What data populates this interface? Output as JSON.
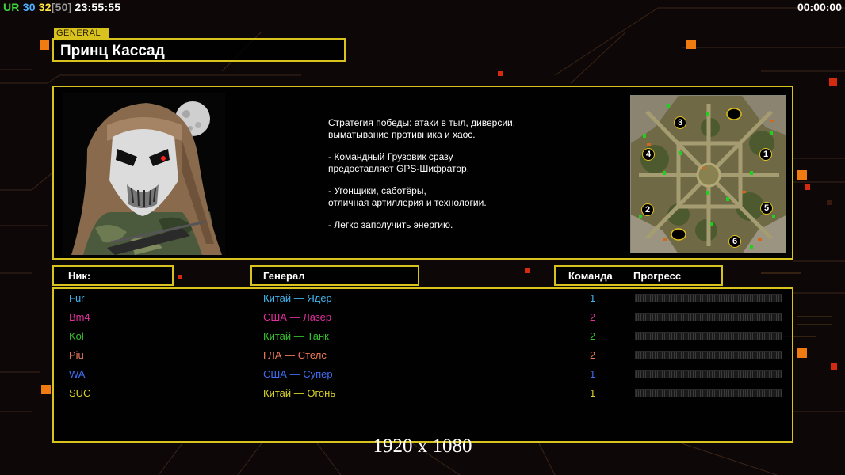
{
  "hud": {
    "left_parts": [
      {
        "text": "UR ",
        "color": "#3fd43f"
      },
      {
        "text": "30 ",
        "color": "#4ab0ff"
      },
      {
        "text": "32",
        "color": "#ffe640"
      },
      {
        "text": "[50]",
        "color": "#9a9a9a"
      },
      {
        "text": " 23:55:55",
        "color": "#ffffff"
      }
    ],
    "timer": "00:00:00"
  },
  "general": {
    "tag": "GENERAL",
    "name": "Принц Кассад",
    "description": [
      "Стратегия победы: атаки в тыл, диверсии,\n выматывание противника и хаос.",
      "- Командный Грузовик сразу\nпредоставляет GPS-Шифратор.",
      "- Угонщики, саботёры,\nотличная артиллерия и технологии.",
      "- Легко заполучить энергию."
    ]
  },
  "minimap": {
    "start_positions": [
      "1",
      "2",
      "3",
      "4",
      "5",
      "6"
    ]
  },
  "table": {
    "headers": {
      "nick": "Ник:",
      "general": "Генерал",
      "team": "Команда",
      "progress": "Прогресс"
    },
    "players": [
      {
        "nick": "Fur",
        "general": "Китай — Ядер",
        "team": "1",
        "color": "#3fb6ee",
        "progress": 0
      },
      {
        "nick": "Bm4",
        "general": "США — Лазер",
        "team": "2",
        "color": "#e0309c",
        "progress": 0
      },
      {
        "nick": "Kol",
        "general": "Китай — Танк",
        "team": "2",
        "color": "#34c22e",
        "progress": 0
      },
      {
        "nick": "Piu",
        "general": "ГЛА — Стелс",
        "team": "2",
        "color": "#ee7a5a",
        "progress": 0
      },
      {
        "nick": "WA",
        "general": "США — Супер",
        "team": "1",
        "color": "#3f6df0",
        "progress": 0
      },
      {
        "nick": "SUC",
        "general": "Китай — Огонь",
        "team": "1",
        "color": "#d8d22a",
        "progress": 0
      }
    ]
  },
  "resolution_label": "1920 x 1080",
  "colors": {
    "frame": "#d8c21e",
    "accent_square": "#f07b10",
    "red_square": "#d42a10"
  }
}
